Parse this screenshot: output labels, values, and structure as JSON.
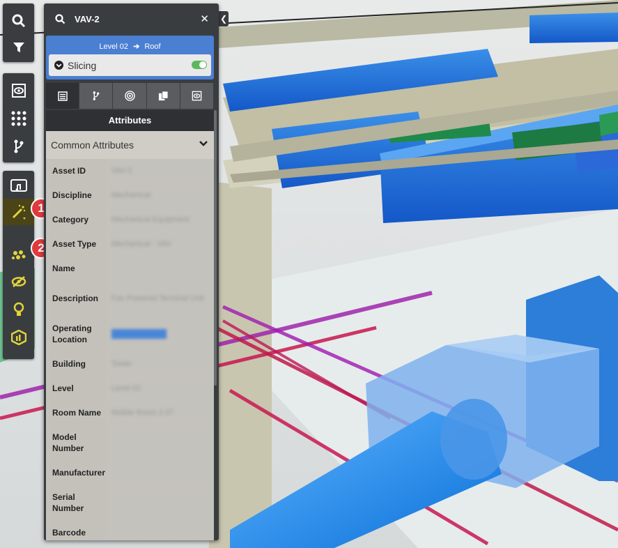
{
  "search": {
    "value": "VAV-2"
  },
  "slicing": {
    "from": "Level 02",
    "to": "Roof",
    "label": "Slicing",
    "enabled": true
  },
  "tabs": [
    "attributes-tab",
    "hierarchy-tab",
    "target-tab",
    "documents-tab",
    "view-tab"
  ],
  "panel": {
    "section_title": "Attributes",
    "group_title": "Common Attributes"
  },
  "badges": {
    "first": "1",
    "second": "2"
  },
  "attributes": [
    {
      "key": "Asset ID",
      "value": "VAV-2"
    },
    {
      "key": "Discipline",
      "value": "Mechanical"
    },
    {
      "key": "Category",
      "value": "Mechanical Equipment"
    },
    {
      "key": "Asset Type",
      "value": "Mechanical - VAV"
    },
    {
      "key": "Name",
      "value": ""
    },
    {
      "key": "Description",
      "value": "Fan Powered Terminal Unit"
    },
    {
      "key": "Operating Location",
      "value": "Level 02 Area"
    },
    {
      "key": "Building",
      "value": "Tower"
    },
    {
      "key": "Level",
      "value": "Level 02"
    },
    {
      "key": "Room Name",
      "value": "Mobile Room 2 07"
    },
    {
      "key": "Model Number",
      "value": ""
    },
    {
      "key": "Manufacturer",
      "value": ""
    },
    {
      "key": "Serial Number",
      "value": ""
    },
    {
      "key": "Barcode",
      "value": ""
    }
  ],
  "colors": {
    "accent": "#4a7fd1",
    "toolbar": "#3a3d40",
    "active_tool": "#e3d43a",
    "badge": "#e0393e"
  }
}
